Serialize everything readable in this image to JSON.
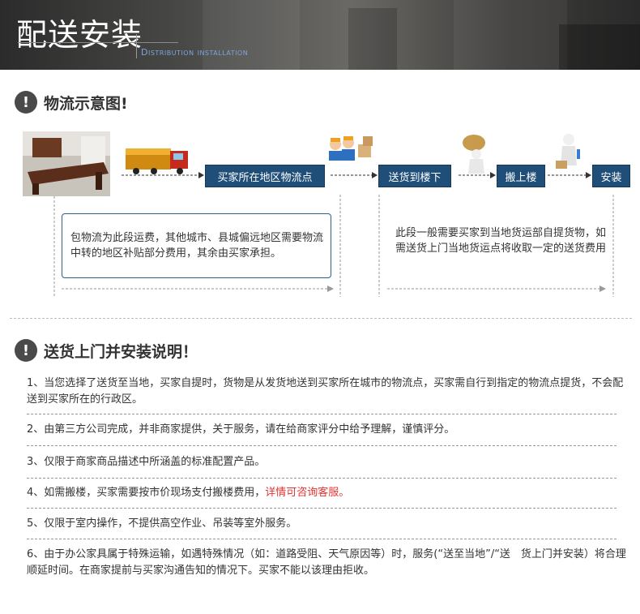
{
  "banner": {
    "title": "配送安装",
    "subtitle": "Distribution installation"
  },
  "section1": {
    "icon": "!",
    "title": "物流示意图!"
  },
  "flow": {
    "steps": [
      "买家所在地区物流点",
      "送货到楼下",
      "搬上楼",
      "安装"
    ],
    "left_note": "包物流为此段运费，其他城市、县城偏远地区需要物流中转的地区补贴部分费用，其余由买家承担。",
    "right_note": "此段一般需要买家到当地货运部自提货物，如需送货上门当地货运点将收取一定的送货费用"
  },
  "section2": {
    "icon": "!",
    "title": "送货上门并安装说明！"
  },
  "items": [
    {
      "text": "1、当您选择了送货至当地，买家自提时，货物是从发货地送到买家所在城市的物流点，买家需自行到指定的物流点提货，不会配送到买家所在的行政区。"
    },
    {
      "text": "2、由第三方公司完成，并非商家提供，关于服务，请在给商家评分中给予理解，谨慎评分。"
    },
    {
      "text": "3、仅限于商家商品描述中所涵盖的标准配置产品。"
    },
    {
      "text": "4、如需搬楼，买家需要按市价现场支付搬楼费用，",
      "highlight": "详情可咨询客服。"
    },
    {
      "text": "5、仅限于室内操作，不提供高空作业、吊装等室外服务。"
    },
    {
      "text": "6、由于办公家具属于特殊运输，如遇特殊情况（如：道路受阻、天气原因等）时，服务(“送至当地”/“送　货上门并安装）将合理顺延时间。在商家提前与买家沟通告知的情况下。买家不能以该理由拒收。"
    }
  ],
  "colors": {
    "pill": "#1f4e78",
    "highlight": "#e53333",
    "note_border": "#2c5f8f"
  }
}
